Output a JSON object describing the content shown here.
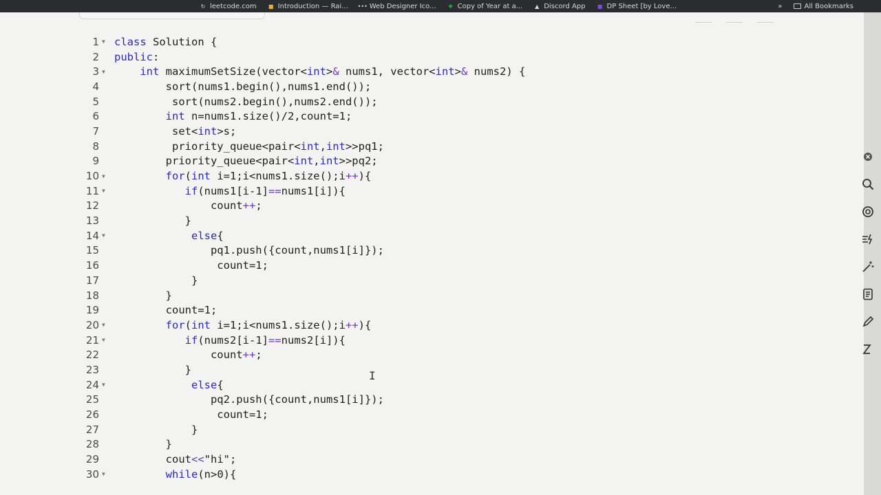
{
  "bookmarks": [
    {
      "label": "leetcode.com",
      "icon": "leetcode-icon"
    },
    {
      "label": "Introduction — Rai...",
      "icon": "page-icon"
    },
    {
      "label": "Web Designer Ico...",
      "icon": "dots-icon"
    },
    {
      "label": "Copy of Year at a...",
      "icon": "sheets-icon"
    },
    {
      "label": "Discord App",
      "icon": "triangle-icon"
    },
    {
      "label": "DP Sheet [by Love...",
      "icon": "purple-icon"
    }
  ],
  "bookmarks_overflow": "»",
  "all_bookmarks": "All Bookmarks",
  "editor": {
    "lines": [
      {
        "n": "1",
        "fold": true,
        "code": "class Solution {"
      },
      {
        "n": "2",
        "fold": false,
        "code": "public:"
      },
      {
        "n": "3",
        "fold": true,
        "code": "    int maximumSetSize(vector<int>& nums1, vector<int>& nums2) {"
      },
      {
        "n": "4",
        "fold": false,
        "code": "        sort(nums1.begin(),nums1.end());"
      },
      {
        "n": "5",
        "fold": false,
        "code": "         sort(nums2.begin(),nums2.end());"
      },
      {
        "n": "6",
        "fold": false,
        "code": "        int n=nums1.size()/2,count=1;"
      },
      {
        "n": "7",
        "fold": false,
        "code": "         set<int>s;"
      },
      {
        "n": "8",
        "fold": false,
        "code": "         priority_queue<pair<int,int>>pq1;"
      },
      {
        "n": "9",
        "fold": false,
        "code": "        priority_queue<pair<int,int>>pq2;"
      },
      {
        "n": "10",
        "fold": true,
        "code": "        for(int i=1;i<nums1.size();i++){"
      },
      {
        "n": "11",
        "fold": true,
        "code": "           if(nums1[i-1]==nums1[i]){"
      },
      {
        "n": "12",
        "fold": false,
        "code": "               count++;"
      },
      {
        "n": "13",
        "fold": false,
        "code": "           }"
      },
      {
        "n": "14",
        "fold": true,
        "code": "            else{"
      },
      {
        "n": "15",
        "fold": false,
        "code": "               pq1.push({count,nums1[i]});"
      },
      {
        "n": "16",
        "fold": false,
        "code": "                count=1;"
      },
      {
        "n": "17",
        "fold": false,
        "code": "            }"
      },
      {
        "n": "18",
        "fold": false,
        "code": "        }"
      },
      {
        "n": "19",
        "fold": false,
        "code": "        count=1;"
      },
      {
        "n": "20",
        "fold": true,
        "code": "        for(int i=1;i<nums1.size();i++){"
      },
      {
        "n": "21",
        "fold": true,
        "code": "           if(nums2[i-1]==nums2[i]){"
      },
      {
        "n": "22",
        "fold": false,
        "code": "               count++;"
      },
      {
        "n": "23",
        "fold": false,
        "code": "           }"
      },
      {
        "n": "24",
        "fold": true,
        "code": "            else{"
      },
      {
        "n": "25",
        "fold": false,
        "code": "               pq2.push({count,nums1[i]});"
      },
      {
        "n": "26",
        "fold": false,
        "code": "                count=1;"
      },
      {
        "n": "27",
        "fold": false,
        "code": "            }"
      },
      {
        "n": "28",
        "fold": false,
        "code": "        }"
      },
      {
        "n": "29",
        "fold": false,
        "code": "        cout<<\"hi\";"
      },
      {
        "n": "30",
        "fold": true,
        "code": "        while(n>0){"
      }
    ],
    "cursor": "I"
  },
  "side_tools": [
    "close-icon",
    "search-icon",
    "settings-icon",
    "format-icon",
    "magic-icon",
    "notes-icon",
    "pen-icon",
    "sleep-icon"
  ]
}
